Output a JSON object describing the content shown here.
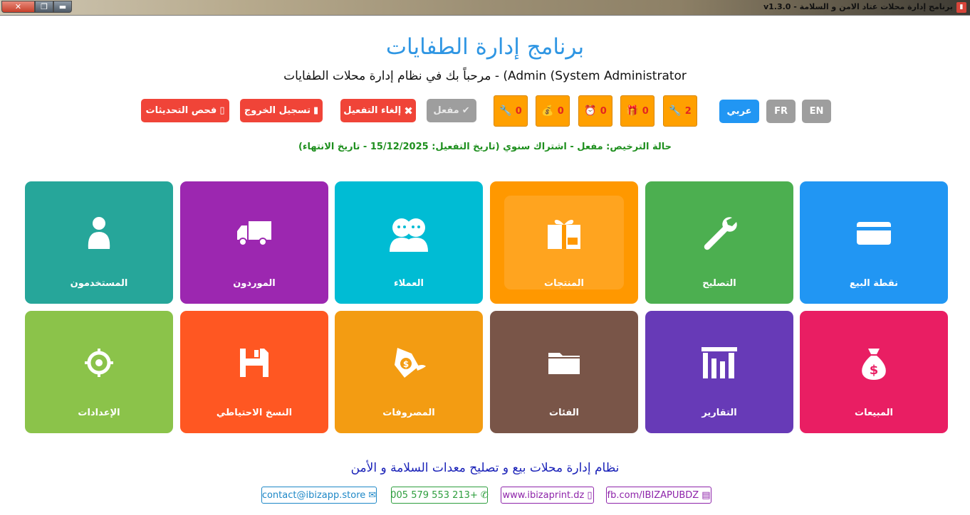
{
  "window": {
    "title": "برنامج إدارة محلات عتاد الامن و السلامة - v1.3.0",
    "close": "✕",
    "maximize": "❐",
    "minimize": "▬"
  },
  "header": {
    "title": "برنامج إدارة الطفايات",
    "welcome": "مرحباً بك في نظام إدارة محلات الطفايات - (Admin (System Administrator"
  },
  "toolbar": {
    "check_updates": "فحص التحديثات",
    "logout": "تسجيل الخروج",
    "deactivate": "إلغاء التفعيل",
    "activated": "مفعل",
    "languages": {
      "ar": "عربي",
      "fr": "FR",
      "en": "EN"
    },
    "badges": [
      {
        "icon": "wrench-icon",
        "count": "0"
      },
      {
        "icon": "money-bag-icon",
        "count": "0"
      },
      {
        "icon": "alarm-clock-icon",
        "count": "0"
      },
      {
        "icon": "gift-icon",
        "count": "0"
      },
      {
        "icon": "wrench-icon",
        "count": "2"
      }
    ]
  },
  "license": {
    "text": "حالة الترخيص: مفعل - اشتراك سنوي (تاريخ التفعيل: 15/12/2025 - تاريخ الانتهاء)"
  },
  "tiles": [
    {
      "label": "نقطة البيع",
      "icon": "card-icon",
      "color": "#2196f3"
    },
    {
      "label": "التصليح",
      "icon": "wrench-icon",
      "color": "#4caf50"
    },
    {
      "label": "المنتجات",
      "icon": "gift-icon",
      "color": "#ff9800"
    },
    {
      "label": "العملاء",
      "icon": "users-icon",
      "color": "#00bcd4"
    },
    {
      "label": "الموردون",
      "icon": "truck-icon",
      "color": "#9c27b0"
    },
    {
      "label": "المستخدمون",
      "icon": "user-icon",
      "color": "#26a69a"
    },
    {
      "label": "المبيعات",
      "icon": "money-bag-icon",
      "color": "#e91e63"
    },
    {
      "label": "التقارير",
      "icon": "bar-chart-icon",
      "color": "#673ab7"
    },
    {
      "label": "الفئات",
      "icon": "folder-icon",
      "color": "#795548"
    },
    {
      "label": "المصروفات",
      "icon": "money-wings-icon",
      "color": "#f39c12"
    },
    {
      "label": "النسخ الاحتياطي",
      "icon": "floppy-icon",
      "color": "#ff5722"
    },
    {
      "label": "الإعدادات",
      "icon": "gear-icon",
      "color": "#8bc34a"
    }
  ],
  "footer": {
    "title": "نظام إدارة محلات بيع و تصليح معدات السلامة و الأمن",
    "facebook": "fb.com/IBIZAPUBDZ",
    "website": "www.ibizaprint.dz",
    "phone": "+213 553 579 005",
    "email": "contact@ibizapp.store"
  }
}
